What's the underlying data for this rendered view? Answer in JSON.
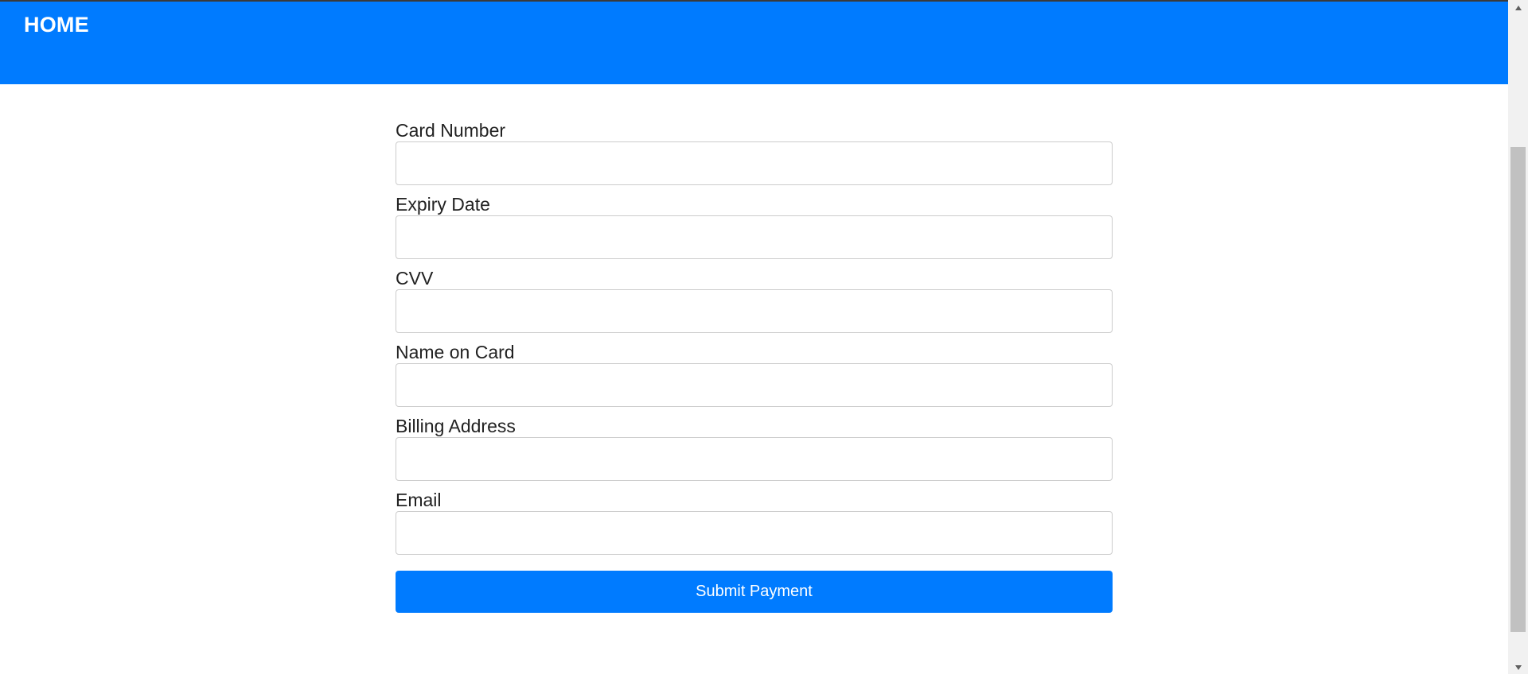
{
  "header": {
    "home_label": "HOME",
    "background_color": "#007bff"
  },
  "form": {
    "fields": [
      {
        "label": "Card Number",
        "value": "",
        "placeholder": ""
      },
      {
        "label": "Expiry Date",
        "value": "",
        "placeholder": ""
      },
      {
        "label": "CVV",
        "value": "",
        "placeholder": ""
      },
      {
        "label": "Name on Card",
        "value": "",
        "placeholder": ""
      },
      {
        "label": "Billing Address",
        "value": "",
        "placeholder": ""
      },
      {
        "label": "Email",
        "value": "",
        "placeholder": ""
      }
    ],
    "submit_label": "Submit Payment",
    "submit_color": "#007bff"
  },
  "scrollbar": {
    "up_icon": "triangle-up-icon",
    "down_icon": "triangle-down-icon"
  }
}
